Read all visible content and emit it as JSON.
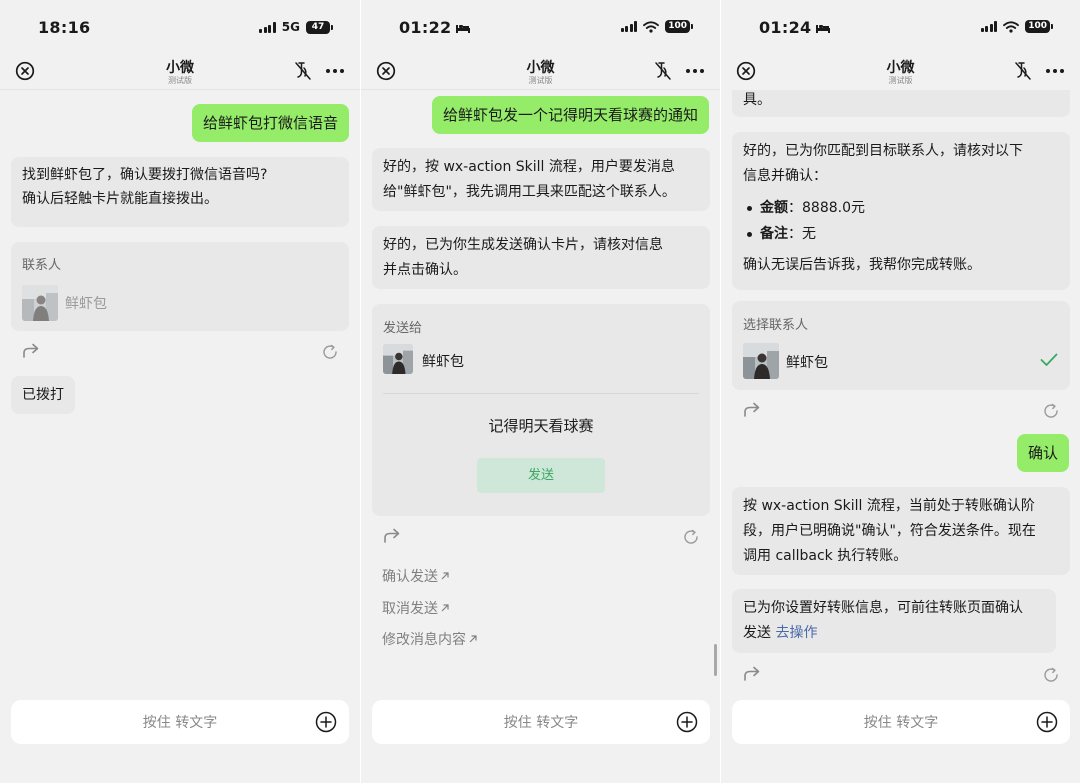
{
  "screens": [
    {
      "status": {
        "time": "18:16",
        "network": "5G",
        "battery": "47"
      },
      "nav": {
        "title": "小微",
        "subtitle": "测试版"
      },
      "user_message": "给鲜虾包打微信语音",
      "bot_reply": {
        "line1": "找到鲜虾包了，确认要拨打微信语音吗?",
        "line2": "确认后轻触卡片就能直接拨出。"
      },
      "contact_card": {
        "header": "联系人",
        "name": "鲜虾包"
      },
      "status_bubble": "已拨打",
      "input": {
        "placeholder": "按住 转文字"
      }
    },
    {
      "status": {
        "time": "01:22",
        "battery": "100"
      },
      "nav": {
        "title": "小微",
        "subtitle": "测试版"
      },
      "user_message": "给鲜虾包发一个记得明天看球赛的通知",
      "bot_reply1": {
        "line1": "好的，按 wx-action Skill 流程，用户要发消息",
        "line2": "给\"鲜虾包\"，我先调用工具来匹配这个联系人。"
      },
      "bot_reply2": {
        "line1": "好的，已为你生成发送确认卡片，请核对信息",
        "line2": "并点击确认。"
      },
      "send_card": {
        "header": "发送给",
        "name": "鲜虾包",
        "message": "记得明天看球赛",
        "send_label": "发送"
      },
      "suggestions": [
        "确认发送",
        "取消发送",
        "修改消息内容"
      ],
      "input": {
        "placeholder": "按住 转文字"
      }
    },
    {
      "status": {
        "time": "01:24",
        "battery": "100"
      },
      "nav": {
        "title": "小微",
        "subtitle": "测试版"
      },
      "tail_text": "具。",
      "bot_reply1": {
        "line1": "好的，已为你匹配到目标联系人，请核对以下",
        "line2": "信息并确认：",
        "amount_label": "金额",
        "amount_value": "8888.0元",
        "note_label": "备注",
        "note_value": "无",
        "closing": "确认无误后告诉我，我帮你完成转账。"
      },
      "select_card": {
        "header": "选择联系人",
        "name": "鲜虾包"
      },
      "user_message": "确认",
      "bot_reply2": {
        "line1": "按 wx-action Skill 流程，当前处于转账确认阶",
        "line2": "段，用户已明确说\"确认\"，符合发送条件。现在",
        "line3": "调用 callback 执行转账。"
      },
      "bot_reply3": {
        "line1": "已为你设置好转账信息，可前往转账页面确认",
        "line2_prefix": "发送",
        "link": "去操作"
      },
      "input": {
        "placeholder": "按住 转文字"
      }
    }
  ]
}
